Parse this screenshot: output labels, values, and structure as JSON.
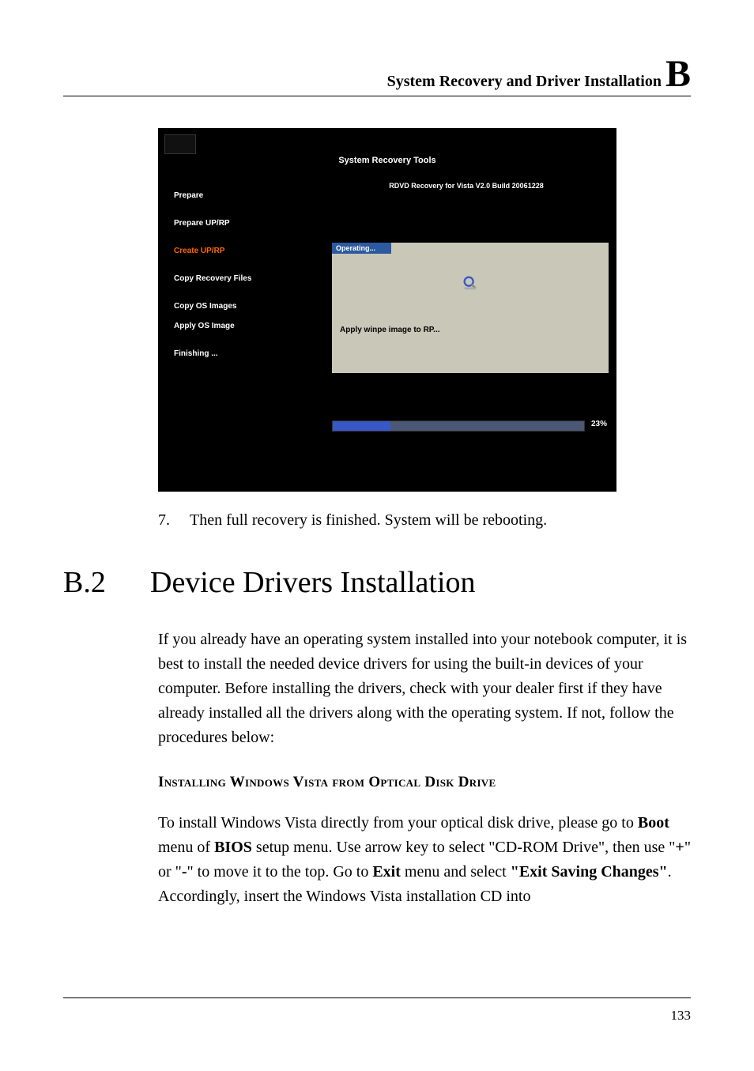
{
  "header": {
    "text": "System Recovery and Driver Installation ",
    "letter": "B"
  },
  "screenshot": {
    "title": "System Recovery Tools",
    "right_header": "RDVD Recovery for Vista V2.0 Build 20061228",
    "left_items": [
      {
        "label": "Prepare",
        "active": false
      },
      {
        "label": "Prepare UP/RP",
        "active": false
      },
      {
        "label": "Create UP/RP",
        "active": true
      },
      {
        "label": "Copy Recovery Files",
        "active": false
      },
      {
        "label": "Copy OS Images",
        "active": false
      },
      {
        "label": "Apply OS Image",
        "active": false
      },
      {
        "label": "Finishing ...",
        "active": false
      }
    ],
    "box_title": "Operating...",
    "box_text": "Apply winpe image to RP...",
    "progress": "23%"
  },
  "step": {
    "num": "7.",
    "text": "Then full recovery is finished. System will be rebooting."
  },
  "section": {
    "num": "B.2",
    "title": "Device Drivers Installation"
  },
  "para1": "If you already have an operating system installed into your notebook computer, it is best to install the needed device drivers for using the built-in devices of your computer. Before installing the drivers, check with your dealer first if they have already installed all the drivers along with the operating system. If not, follow the procedures below:",
  "subheading": "Installing Windows Vista from Optical Disk Drive",
  "para2": {
    "t1": "To install Windows Vista directly from your optical disk drive, please go to ",
    "b1": "Boot",
    "t2": " menu of ",
    "b2": "BIOS",
    "t3": " setup menu. Use arrow key to select \"CD-ROM Drive\", then use \"",
    "b3": "+",
    "t4": "\" or \"",
    "b4": "-",
    "t5": "\" to move it to the top. Go to ",
    "b5": "Exit",
    "t6": " menu and select ",
    "b6": "\"Exit Saving Changes\"",
    "t7": ". Accordingly, insert the Windows Vista installation CD into"
  },
  "page_num": "133"
}
